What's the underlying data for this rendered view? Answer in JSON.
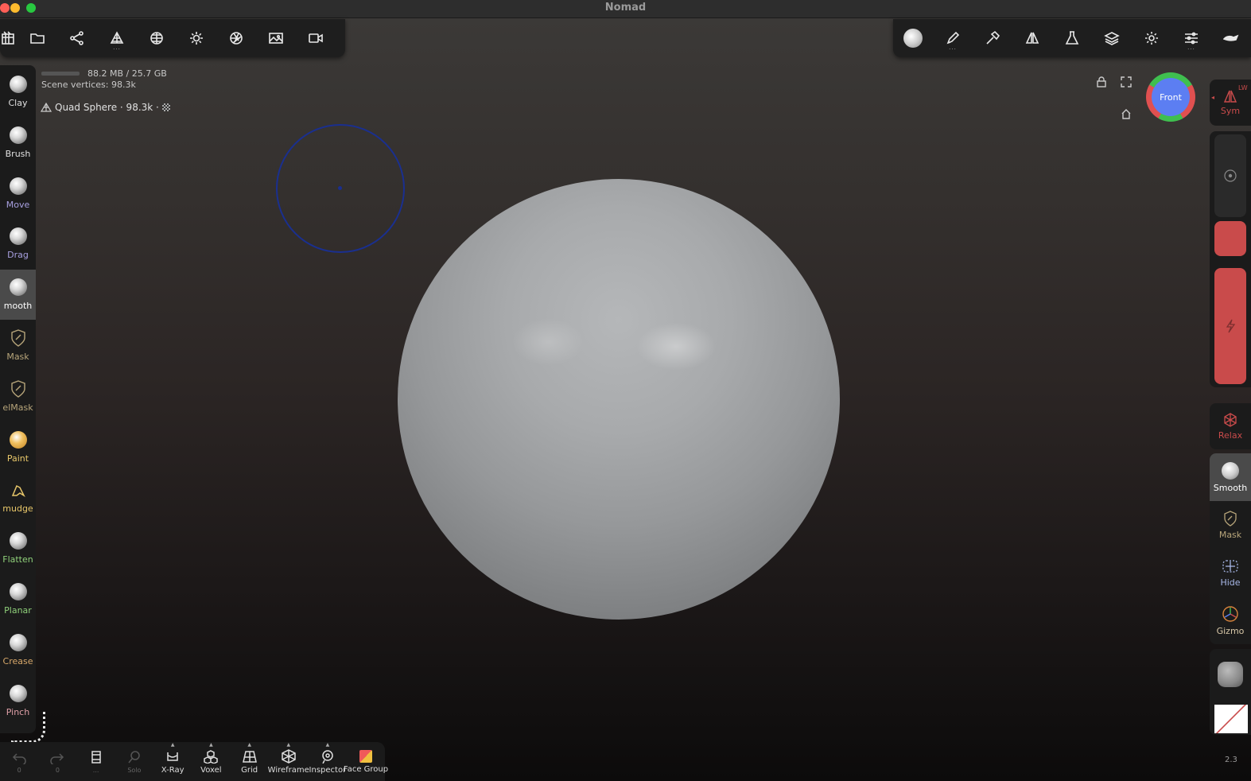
{
  "window": {
    "title": "Nomad"
  },
  "colors": {
    "close": "#fe5f57",
    "minimize": "#febc2e",
    "maximize": "#28c840",
    "cursor_ring": "#1a2f8f",
    "active_tool_bg": "#4a4a4a",
    "sym_red": "#c94b4b",
    "mask_tan": "#b7a57a",
    "paint_yellow": "#e8c76a",
    "move_purple": "#a8a0e0",
    "flatten_green": "#8fd07a",
    "crease_orange": "#d8a86a",
    "pinch_pink": "#e0a0a8",
    "gizmo_face": "#5c7ef2"
  },
  "top_toolbar_left": {
    "icons": [
      "scene-icon",
      "folder-icon",
      "share-nodes-icon",
      "topology-icon",
      "sphere-grid-icon",
      "light-icon",
      "camera-aperture-icon",
      "image-icon",
      "video-camera-icon"
    ]
  },
  "top_toolbar_right": {
    "icons": [
      "smooth-brush-icon",
      "pen-icon",
      "hammer-icon",
      "symmetry-icon",
      "flask-icon",
      "layers-icon",
      "gear-icon",
      "sliders-icon",
      "mesh-fill-icon"
    ]
  },
  "info": {
    "memory": "88.2 MB / 25.7 GB",
    "scene_vertices": "Scene vertices:  98.3k",
    "object": "Quad Sphere · 98.3k ·"
  },
  "left_tools": [
    {
      "label": "Clay",
      "color": "#e0e0e0"
    },
    {
      "label": "Brush",
      "color": "#e0e0e0"
    },
    {
      "label": "Move",
      "color": "#a8a0e0"
    },
    {
      "label": "Drag",
      "color": "#a8a0e0"
    },
    {
      "label": "mooth",
      "color": "#ffffff",
      "active": true
    },
    {
      "label": "Mask",
      "color": "#b7a57a"
    },
    {
      "label": "elMask",
      "color": "#b7a57a"
    },
    {
      "label": "Paint",
      "color": "#e8c76a"
    },
    {
      "label": "mudge",
      "color": "#e8c76a"
    },
    {
      "label": "Flatten",
      "color": "#8fd07a"
    },
    {
      "label": "Planar",
      "color": "#8fd07a"
    },
    {
      "label": "Crease",
      "color": "#d8a86a"
    },
    {
      "label": "Pinch",
      "color": "#e0a0a8"
    }
  ],
  "view": {
    "gizmo_label": "Front"
  },
  "right_panel": {
    "sym_label": "Sym",
    "relax_label": "Relax",
    "smooth_label": "Smooth",
    "mask_label": "Mask",
    "hide_label": "Hide",
    "gizmo_label": "Gizmo",
    "corner_label": "LW",
    "version": "2.3"
  },
  "bottom_toolbar": [
    {
      "name": "undo",
      "label": "",
      "sub": "0",
      "icon": "undo-icon",
      "dim": true
    },
    {
      "name": "redo",
      "label": "",
      "sub": "0",
      "icon": "redo-icon",
      "dim": true
    },
    {
      "name": "pages",
      "label": "",
      "sub": "...",
      "icon": "pages-icon"
    },
    {
      "name": "solo",
      "label": "",
      "sub": "Solo",
      "icon": "search-icon",
      "dim": true
    },
    {
      "name": "xray",
      "label": "X-Ray",
      "icon": "xray-icon"
    },
    {
      "name": "voxel",
      "label": "Voxel",
      "icon": "voxel-icon"
    },
    {
      "name": "grid",
      "label": "Grid",
      "icon": "grid-icon"
    },
    {
      "name": "wireframe",
      "label": "Wireframe",
      "icon": "wireframe-icon"
    },
    {
      "name": "inspector",
      "label": "Inspector",
      "icon": "inspector-icon"
    },
    {
      "name": "facegroup",
      "label": "Face Group",
      "icon": "face-group-icon"
    }
  ]
}
